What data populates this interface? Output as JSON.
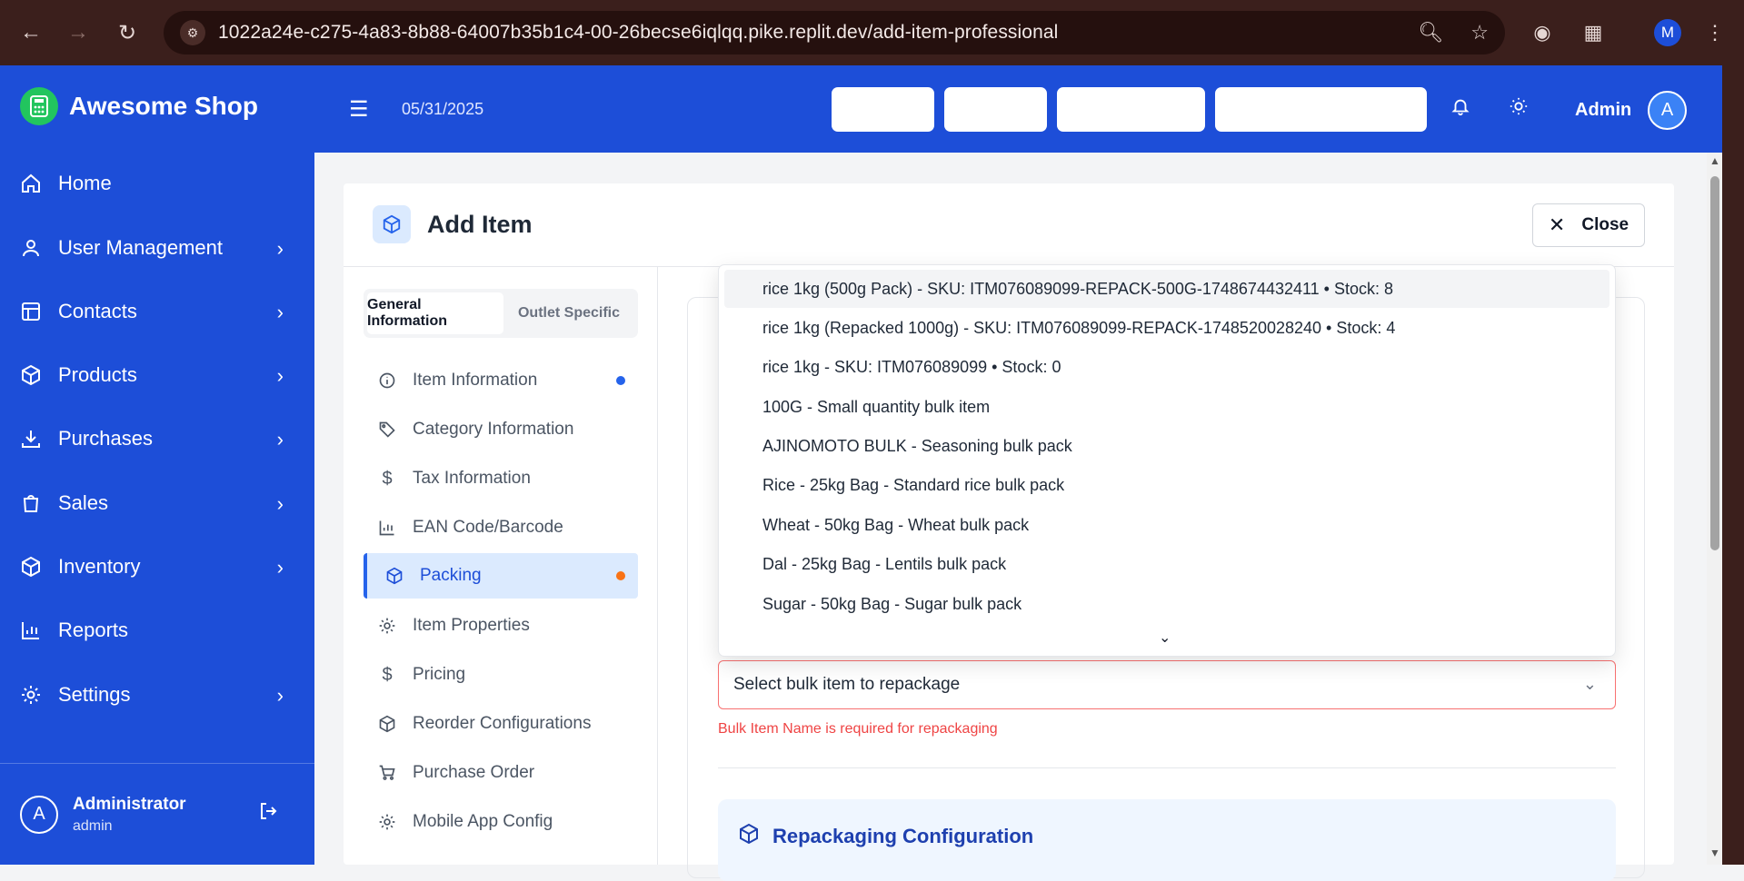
{
  "browser": {
    "url": "1022a24e-c275-4a83-8b88-64007b35b1c4-00-26becse6iqlqq.pike.replit.dev/add-item-professional",
    "profile_initial": "M"
  },
  "sidebar": {
    "brand": "Awesome Shop",
    "items": [
      {
        "label": "Home",
        "icon": "home-icon",
        "has_chevron": false
      },
      {
        "label": "User Management",
        "icon": "user-icon",
        "has_chevron": true
      },
      {
        "label": "Contacts",
        "icon": "contacts-icon",
        "has_chevron": true
      },
      {
        "label": "Products",
        "icon": "box-icon",
        "has_chevron": true
      },
      {
        "label": "Purchases",
        "icon": "download-icon",
        "has_chevron": true
      },
      {
        "label": "Sales",
        "icon": "bag-icon",
        "has_chevron": true
      },
      {
        "label": "Inventory",
        "icon": "box-icon",
        "has_chevron": true
      },
      {
        "label": "Reports",
        "icon": "bar-chart-icon",
        "has_chevron": false
      },
      {
        "label": "Settings",
        "icon": "gear-icon",
        "has_chevron": true
      }
    ],
    "user": {
      "initial": "A",
      "name": "Administrator",
      "role": "admin"
    }
  },
  "header": {
    "date": "05/31/2025",
    "admin_label": "Admin",
    "admin_initial": "A"
  },
  "card": {
    "title": "Add Item",
    "close_label": "Close",
    "tabs": [
      "General Information",
      "Outlet Specific"
    ],
    "sections": [
      {
        "label": "Item Information",
        "icon": "info-icon",
        "dot": "#2563eb"
      },
      {
        "label": "Category Information",
        "icon": "tag-icon"
      },
      {
        "label": "Tax Information",
        "icon": "dollar-icon"
      },
      {
        "label": "EAN Code/Barcode",
        "icon": "bar-chart-icon"
      },
      {
        "label": "Packing",
        "icon": "box-icon",
        "dot": "#f97316",
        "active": true
      },
      {
        "label": "Item Properties",
        "icon": "gear-icon"
      },
      {
        "label": "Pricing",
        "icon": "dollar-icon"
      },
      {
        "label": "Reorder Configurations",
        "icon": "box-icon"
      },
      {
        "label": "Purchase Order",
        "icon": "cart-icon"
      },
      {
        "label": "Mobile App Config",
        "icon": "gear-icon"
      }
    ],
    "bulk_select": {
      "placeholder": "Select bulk item to repackage",
      "error": "Bulk Item Name is required for repackaging",
      "options": [
        "rice 1kg (500g Pack) - SKU: ITM076089099-REPACK-500G-1748674432411 • Stock: 8",
        "rice 1kg (Repacked 1000g) - SKU: ITM076089099-REPACK-1748520028240 • Stock: 4",
        "rice 1kg - SKU: ITM076089099 • Stock: 0",
        "100G - Small quantity bulk item",
        "AJINOMOTO BULK - Seasoning bulk pack",
        "Rice - 25kg Bag - Standard rice bulk pack",
        "Wheat - 50kg Bag - Wheat bulk pack",
        "Dal - 25kg Bag - Lentils bulk pack",
        "Sugar - 50kg Bag - Sugar bulk pack"
      ]
    },
    "repack_title": "Repackaging Configuration"
  },
  "colors": {
    "brand_blue": "#1d4ed8",
    "error": "#ef4444",
    "active_dot": "#f97316"
  }
}
